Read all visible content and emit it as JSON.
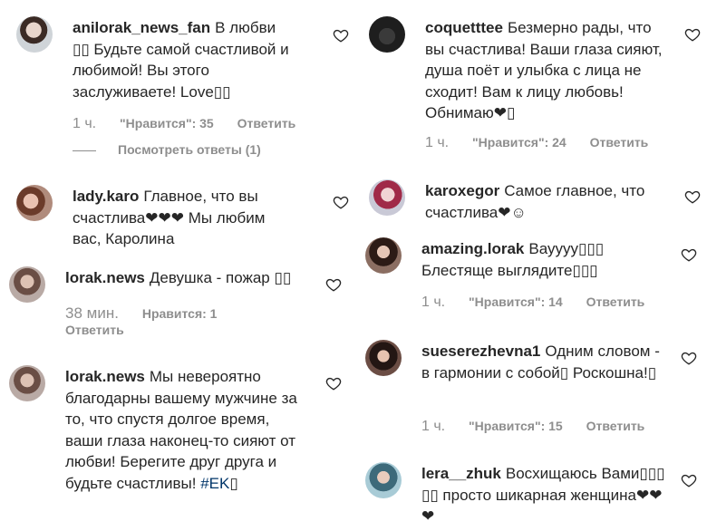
{
  "left": [
    {
      "avatar": "c1",
      "user": "anilorak_news_fan",
      "text": "В любви ▯▯ Будьте самой счастливой и любимой! Вы этого заслуживаете! Love▯▯",
      "time": "1 ч.",
      "likes": "\"Нравится\": 35",
      "reply": "Ответить",
      "view_replies": "Посмотреть ответы (1)"
    },
    {
      "avatar": "c3",
      "user": "lady.karo",
      "text": "Главное, что вы счастлива❤❤❤ Мы любим вас, Каролина"
    },
    {
      "avatar": "c5",
      "user": "lorak.news",
      "text": "Девушка - пожар ▯▯",
      "time": "38 мин.",
      "likes": "Нравится: 1",
      "reply": "Ответить"
    },
    {
      "avatar": "c5",
      "user": "lorak.news",
      "text": "Мы невероятно благодарны вашему мужчине за то, что спустя долгое время, ваши глаза наконец-то сияют от любви! Берегите друг друга и будьте счастливы!",
      "hashtag": "#EK",
      "tail": "▯"
    }
  ],
  "right": [
    {
      "avatar": "c2",
      "user": "coquetttee",
      "text": "Безмерно рады, что вы счастлива! Ваши глаза сияют, душа поёт и улыбка с лица не сходит! Вам к лицу любовь! Обнимаю❤▯",
      "time": "1 ч.",
      "likes": "\"Нравится\": 24",
      "reply": "Ответить"
    },
    {
      "avatar": "c4",
      "user": "karoxegor",
      "text": "Самое главное, что счастлива❤☺"
    },
    {
      "avatar": "c6",
      "user": "amazing.lorak",
      "text": "Вауууу▯▯▯ Блестяще выглядите▯▯▯",
      "time": "1 ч.",
      "likes": "\"Нравится\": 14",
      "reply": "Ответить"
    },
    {
      "avatar": "c7",
      "user": "sueserezhevna1",
      "text": "Одним словом - в гармонии с собой▯ Роскошна!▯",
      "time": "1 ч.",
      "likes": "\"Нравится\": 15",
      "reply": "Ответить"
    },
    {
      "avatar": "c8",
      "user": "lera__zhuk",
      "text": "Восхищаюсь Вами▯▯▯ ▯▯ просто шикарная женщина❤❤ ❤"
    }
  ],
  "icons": {
    "like": "heart-outline-icon",
    "color_meta": "#8e8e8e",
    "color_text": "#262626",
    "color_hashtag": "#003569"
  }
}
